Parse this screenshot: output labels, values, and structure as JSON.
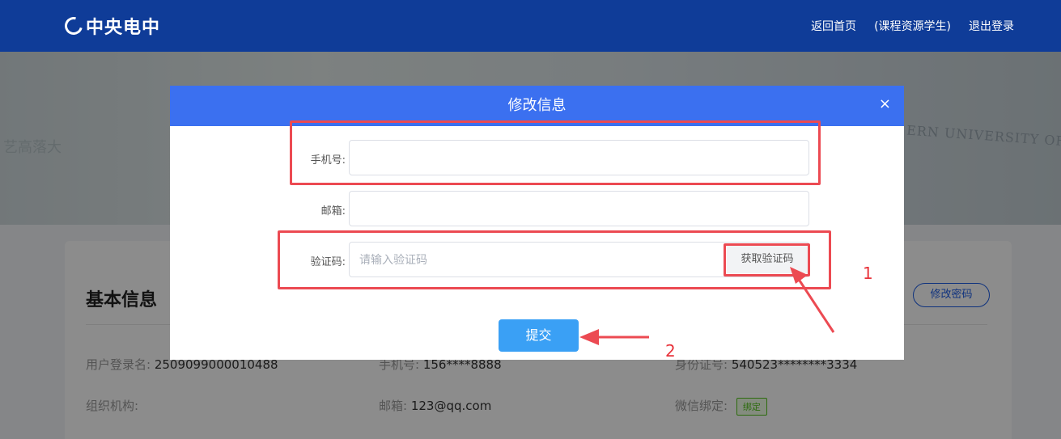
{
  "header": {
    "logo_text": "中央电中",
    "nav": [
      "返回首页",
      "(课程资源学生)",
      "退出登录"
    ]
  },
  "hero": {
    "text": "ERN UNIVERSITY OF A",
    "text_left": "艺高落大"
  },
  "card": {
    "title": "基本信息",
    "change_password": "修改密码",
    "fields": {
      "username_label": "用户登录名:",
      "username_value": "2509099000010488",
      "phone_label": "手机号:",
      "phone_value": "156****8888",
      "id_label": "身份证号:",
      "id_value": "540523********3334",
      "org_label": "组织机构:",
      "email_label": "邮箱:",
      "email_value": "123@qq.com",
      "wechat_label": "微信绑定:",
      "wechat_badge": "绑定"
    }
  },
  "modal": {
    "title": "修改信息",
    "close": "×",
    "phone_label": "手机号:",
    "phone_value": "",
    "email_label": "邮箱:",
    "email_value": "",
    "code_label": "验证码:",
    "code_placeholder": "请输入验证码",
    "get_code": "获取验证码",
    "submit": "提交"
  },
  "annotations": {
    "num1": "1",
    "num2": "2"
  },
  "colors": {
    "topbar": "#0f3c98",
    "modal_header": "#3b70f0",
    "submit": "#3aa0f5",
    "annotation": "#ec4a52"
  }
}
